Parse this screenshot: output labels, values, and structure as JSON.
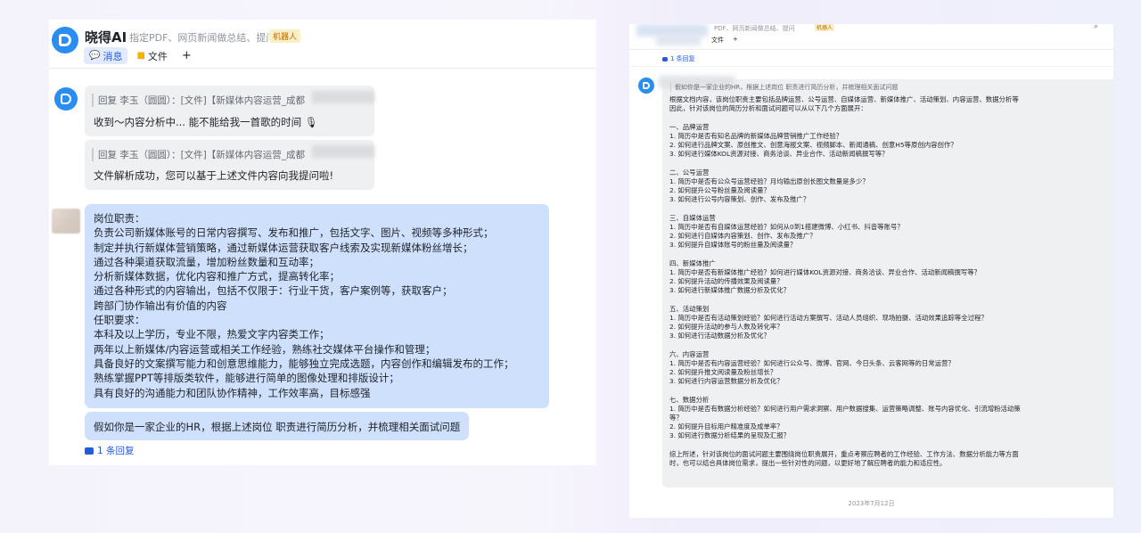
{
  "left": {
    "app_title": "晓得AI",
    "app_desc": "指定PDF、网页新闻做总结、提问",
    "badge": "机器人",
    "tabs": [
      {
        "icon": "message-icon",
        "label": "消息"
      },
      {
        "icon": "folder-icon",
        "label": "文件"
      },
      {
        "icon": "plus-icon",
        "label": "+"
      }
    ],
    "msg1": {
      "quote": "回复 李玉（圆圆）：[文件]【新媒体内容运营_成都",
      "text": "收到～内容分析中... 能不能给我一首歌的时间 🎙"
    },
    "msg2": {
      "quote": "回复 李玉（圆圆）：[文件]【新媒体内容运营_成都",
      "text": "文件解析成功，您可以基于上述文件内容向我提问啦!"
    },
    "jd_lines": [
      "岗位职责：",
      "负责公司新媒体账号的日常内容撰写、发布和推广，包括文字、图片、视频等多种形式；",
      "制定并执行新媒体营销策略，通过新媒体运营获取客户线索及实现新媒体粉丝增长；",
      "通过各种渠道获取流量，增加粉丝数量和互动率；",
      "分析新媒体数据，优化内容和推广方式，提高转化率；",
      "通过各种形式的内容输出，包括不仅限于：行业干货，客户案例等，获取客户；",
      "跨部门协作输出有价值的内容",
      "任职要求：",
      "本科及以上学历，专业不限，热爱文字内容类工作；",
      "两年以上新媒体/内容运营或相关工作经验，熟练社交媒体平台操作和管理；",
      "具备良好的文案撰写能力和创意思维能力，能够独立完成选题，内容创作和编辑发布的工作；",
      "熟练掌握PPT等排版类软件，能够进行简单的图像处理和排版设计；",
      "具有良好的沟通能力和团队协作精神，工作效率高，目标感强"
    ],
    "question": "假如你是一家企业的HR，根据上述岗位 职责进行简历分析，并梳理相关面试问题",
    "reply_link": "1 条回复"
  },
  "right": {
    "app_desc": "PDF、网页新闻做总结、提问",
    "badge": "机器人",
    "tabs": [
      "文件",
      "+"
    ],
    "reply_link": "1 条回复",
    "quote": "假如你是一家企业的HR，根据上述岗位 职责进行简历分析，并梳理相关面试问题",
    "body_lines": [
      "根据文档内容，该岗位职责主要包括品牌运营、公号运营、自媒体运营、新媒体推广、活动策划、内容运营、数据分析等",
      "因此，针对该岗位的简历分析和面试问题可以从以下几个方面展开：",
      "",
      "一、品牌运营",
      "1. 简历中是否有知名品牌的新媒体品牌营销推广工作经验？",
      "2. 如何进行品牌文案、原创推文、创意海报文案、视频脚本、新闻通稿、创意H5等原创内容创作？",
      "3. 如何进行媒体KOL资源对接、商务洽谈、异业合作、活动新闻稿撰写等？",
      "",
      "二、公号运营",
      "1. 简历中是否有公众号运营经验？月均输出原创长图文数量是多少？",
      "2. 如何提升公号粉丝量及阅读量？",
      "3. 如何进行公号内容策划、创作、发布及推广？",
      "",
      "三、自媒体运营",
      "1. 简历中是否有自媒体运营经验？如何从0到1搭建微博、小红书、抖音等账号？",
      "2. 如何进行自媒体内容策划、创作、发布及推广？",
      "3. 如何提升自媒体账号的粉丝量及阅读量？",
      "",
      "四、新媒体推广",
      "1. 简历中是否有新媒体推广经验？如何进行媒体KOL资源对接、商务洽谈、异业合作、活动新闻稿撰写等？",
      "2. 如何提升活动的传播效果及阅读量？",
      "3. 如何进行新媒体推广数据分析及优化？",
      "",
      "五、活动策划",
      "1. 简历中是否有活动策划经验？如何进行活动方案撰写、活动人员组织、现场拍摄、活动效果追踪等全过程？",
      "2. 如何提升活动的参与人数及转化率？",
      "3. 如何进行活动数据分析及优化？",
      "",
      "六、内容运营",
      "1. 简历中是否有内容运营经验？如何进行公众号、微博、官网、今日头条、云客网等的日常运营？",
      "2. 如何提升推文阅读量及粉丝增长？",
      "3. 如何进行内容运营数据分析及优化？",
      "",
      "七、数据分析",
      "1. 简历中是否有数据分析经验？如何进行用户需求洞察、用户数据搜集、运营策略调整、账号内容优化、引流增粉活动策",
      "等？",
      "2. 如何提升目标用户精准度及成单率？",
      "3. 如何进行数据分析结果的呈现及汇报？",
      "",
      "综上所述，针对该岗位的面试问题主要围绕岗位职责展开，重点考察应聘者的工作经验、工作方法、数据分析能力等方面",
      "时，也可以结合具体岗位需求，提出一些针对性的问题，以更好地了解应聘者的能力和适应性。"
    ],
    "date": "2023年7月12日"
  }
}
